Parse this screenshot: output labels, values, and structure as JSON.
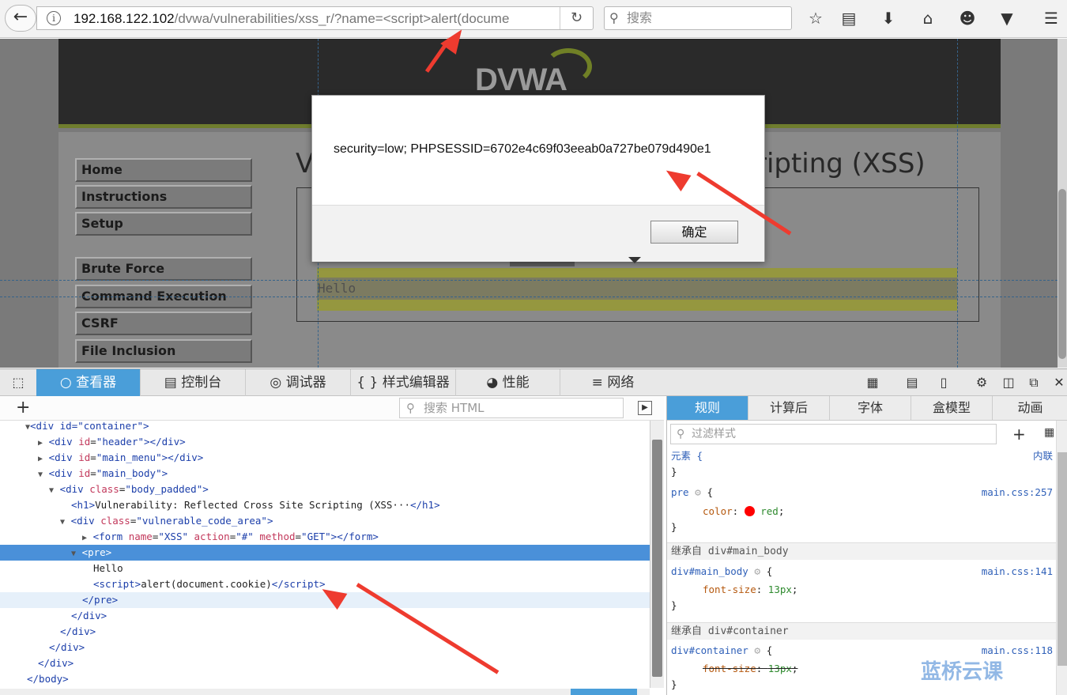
{
  "browser": {
    "url_host": "192.168.122.102",
    "url_path": "/dvwa/vulnerabilities/xss_r/?name=<script>alert(docume",
    "search_placeholder": "搜索"
  },
  "dvwa": {
    "logo_text": "DVWA",
    "page_title_left": "V",
    "page_title_right": "cripting (XSS)",
    "menu": [
      "Home",
      "Instructions",
      "Setup",
      "Brute Force",
      "Command Execution",
      "CSRF",
      "File Inclusion"
    ],
    "pre_text": "Hello"
  },
  "dialog": {
    "message": "security=low; PHPSESSID=6702e4c69f03eeab0a727be079d490e1",
    "ok_label": "确定"
  },
  "devtools": {
    "tabs": [
      "查看器",
      "控制台",
      "调试器",
      "样式编辑器",
      "性能",
      "网络"
    ],
    "html_search_placeholder": "搜索 HTML",
    "tree": {
      "l1_tag": "<div id=\"container\">",
      "l2": "header",
      "l3": "main_menu",
      "l4": "main_body",
      "l5": "body_padded",
      "h1_text": "Vulnerability: Reflected Cross Site Scripting (XSS···",
      "l7": "vulnerable_code_area",
      "form_name": "XSS",
      "form_action": "#",
      "form_method": "GET",
      "pre": "pre",
      "hello": "Hello",
      "script_inner": "alert(document.cookie)",
      "close_pre": "</pre>",
      "close_div": "</div>",
      "close_body": "</body>"
    },
    "rules_tabs": [
      "规则",
      "计算后",
      "字体",
      "盒模型",
      "动画"
    ],
    "filter_placeholder": "过滤样式",
    "rules": {
      "element_sel": "元素 {",
      "element_src": "内联",
      "pre_sel": "pre",
      "pre_src": "main.css:257",
      "pre_prop": "color",
      "pre_val": "red",
      "pre_color": "#ff0000",
      "inh1": "继承自 div#main_body",
      "mb_sel": "div#main_body",
      "mb_src": "main.css:141",
      "mb_prop": "font-size",
      "mb_val": "13px",
      "inh2": "继承自 div#container",
      "ct_sel": "div#container",
      "ct_src": "main.css:118",
      "ct_prop": "font-size",
      "ct_val": "13px"
    }
  },
  "watermark": "蓝桥云课"
}
